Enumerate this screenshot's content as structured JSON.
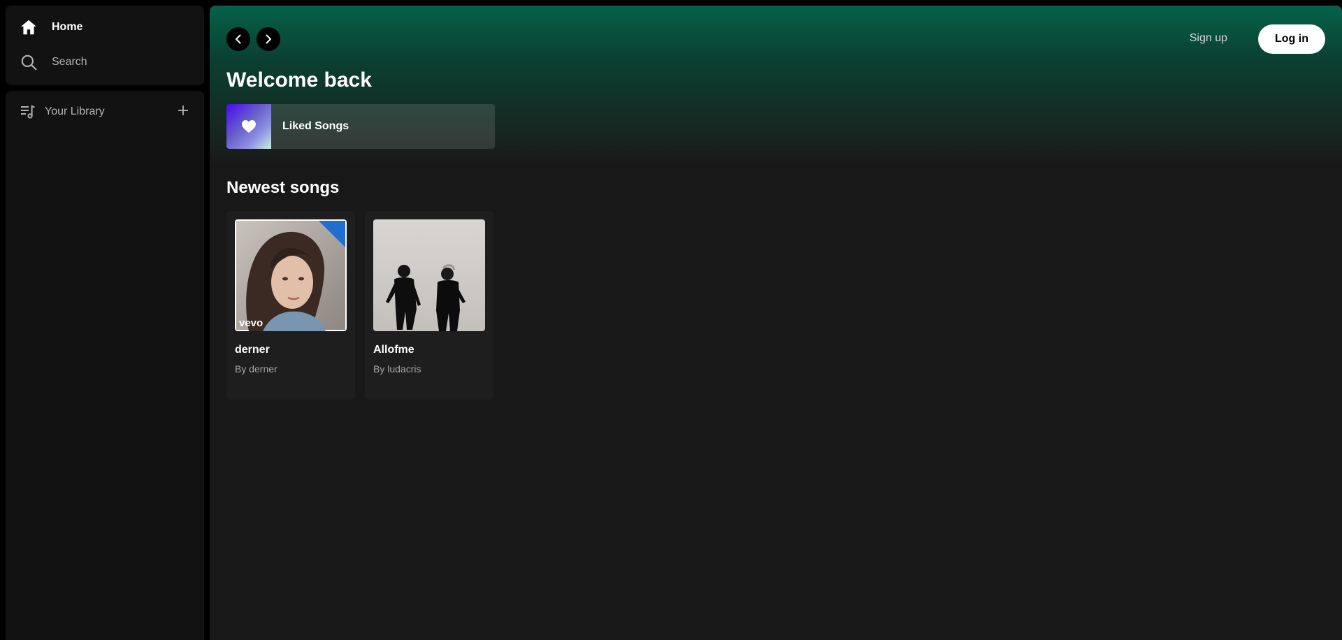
{
  "sidebar": {
    "nav": {
      "home_label": "Home",
      "search_label": "Search"
    },
    "library": {
      "label": "Your Library"
    }
  },
  "header": {
    "signup_label": "Sign up",
    "login_label": "Log in"
  },
  "main": {
    "welcome_title": "Welcome back",
    "liked_songs_label": "Liked Songs",
    "section_title": "Newest songs",
    "songs": [
      {
        "title": "derner",
        "artist": "By derner",
        "cover_watermark": "vevo"
      },
      {
        "title": "Allofme",
        "artist": "By ludacris"
      }
    ]
  },
  "colors": {
    "background": "#000000",
    "panel": "#121212",
    "accent_gradient_top": "#05614a",
    "card": "#1e1e1e",
    "muted_text": "#b3b3b3"
  },
  "icons": {
    "home": "home-icon",
    "search": "search-icon",
    "library": "library-icon",
    "add": "plus-icon",
    "back": "chevron-left-icon",
    "forward": "chevron-right-icon",
    "liked": "heart-icon"
  }
}
